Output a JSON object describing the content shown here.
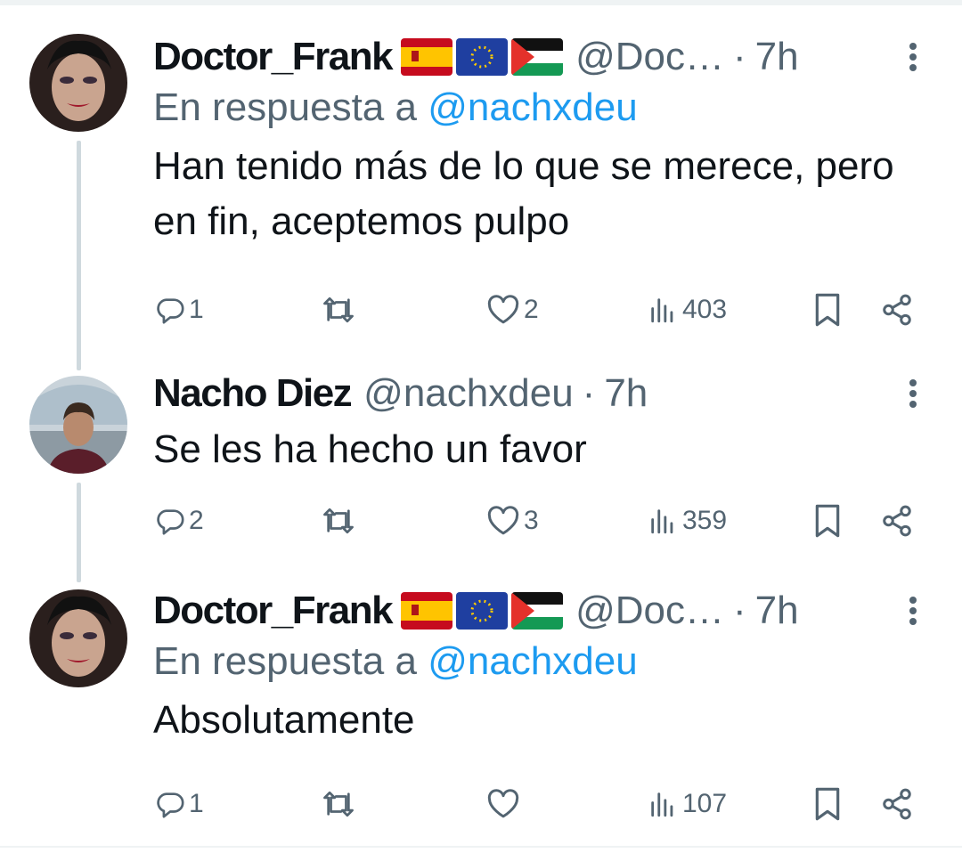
{
  "tweets": [
    {
      "name": "Doctor_Frank",
      "handle": "@Doc…",
      "time": "7h",
      "reply_prefix": "En respuesta a",
      "reply_mention": "@nachxdeu",
      "text": "Han tenido más de lo que se merece, pero en fin, aceptemos pulpo",
      "replies": "1",
      "retweets": "",
      "likes": "2",
      "views": "403"
    },
    {
      "name": "Nacho Diez",
      "handle": "@nachxdeu",
      "time": "7h",
      "text": "Se les ha hecho un favor",
      "replies": "2",
      "retweets": "",
      "likes": "3",
      "views": "359"
    },
    {
      "name": "Doctor_Frank",
      "handle": "@Doc…",
      "time": "7h",
      "reply_prefix": "En respuesta a",
      "reply_mention": "@nachxdeu",
      "text": "Absolutamente",
      "replies": "1",
      "retweets": "",
      "likes": "",
      "views": "107"
    }
  ],
  "separator_dot": "·",
  "colors": {
    "text": "#0f1419",
    "secondary": "#536471",
    "link": "#1d9bf0",
    "thread_line": "#cfd9de"
  },
  "icons": [
    "reply-icon",
    "retweet-icon",
    "like-icon",
    "views-icon",
    "bookmark-icon",
    "share-icon",
    "more-icon"
  ]
}
